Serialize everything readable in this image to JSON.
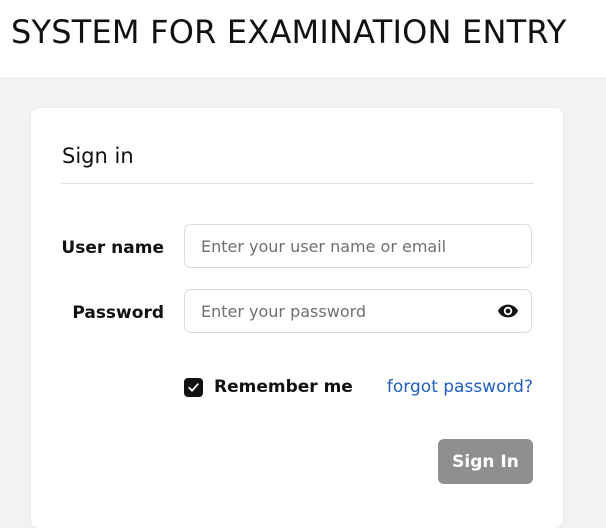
{
  "header": {
    "title": "SYSTEM FOR EXAMINATION ENTRY"
  },
  "login": {
    "title": "Sign in",
    "username": {
      "label": "User name",
      "placeholder": "Enter your user name or email",
      "value": ""
    },
    "password": {
      "label": "Password",
      "placeholder": "Enter your password",
      "value": "",
      "toggle_icon": "eye-icon"
    },
    "remember": {
      "label": "Remember me",
      "checked": true
    },
    "forgot_label": "forgot password?",
    "submit_label": "Sign In"
  },
  "colors": {
    "link": "#1f5fbf",
    "button_disabled": "#8f8f8f",
    "checkbox": "#111111"
  }
}
